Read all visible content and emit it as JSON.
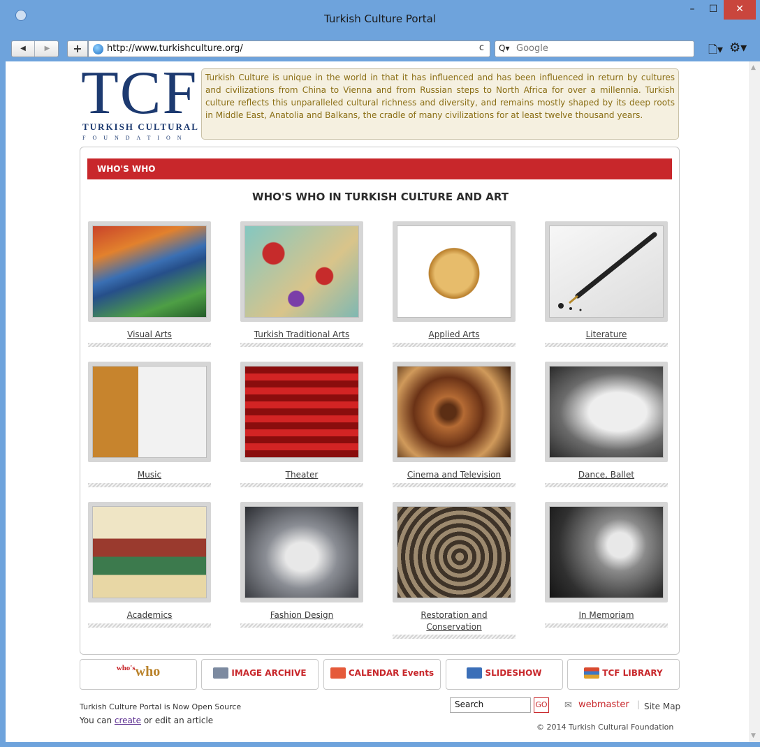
{
  "window": {
    "title": "Turkish Culture Portal",
    "min_glyph": "–",
    "max_glyph": "☐",
    "close_glyph": "✕"
  },
  "browser": {
    "url": "http://www.turkishculture.org/",
    "search_placeholder": "Google",
    "back_glyph": "◀",
    "forward_glyph": "▶",
    "plus_glyph": "+",
    "reload_glyph": "c",
    "search_glyph": "Q▾",
    "page_menu_glyph": "🗋▾",
    "tools_menu_glyph": "⚙▾"
  },
  "logo": {
    "big": "TCF",
    "line1": "TURKISH CULTURAL",
    "line2": "FOUNDATION"
  },
  "intro": "Turkish Culture is unique in the world in that it has influenced and has been influenced in return by cultures and civilizations from China to Vienna and from Russian steps to North Africa for over a millennia. Turkish culture reflects this unparalleled cultural richness and diversity, and remains mostly shaped by its deep roots in Middle East, Anatolia and Balkans, the cradle of many civilizations for at least twelve thousand years.",
  "section": {
    "bar_title": "WHO'S WHO",
    "heading": "WHO'S WHO IN TURKISH CULTURE AND ART"
  },
  "categories": [
    {
      "label": "Visual Arts",
      "image": "visual-arts-photo"
    },
    {
      "label": "Turkish Traditional Arts",
      "image": "marbling-photo"
    },
    {
      "label": "Applied Arts",
      "image": "golden-vase-photo"
    },
    {
      "label": "Literature",
      "image": "fountain-pen-photo"
    },
    {
      "label": "Music",
      "image": "musician-painting"
    },
    {
      "label": "Theater",
      "image": "theater-seats-photo"
    },
    {
      "label": "Cinema and Television",
      "image": "film-reel-photo"
    },
    {
      "label": "Dance, Ballet",
      "image": "ballet-dancer-photo"
    },
    {
      "label": "Academics",
      "image": "miniature-scholars-painting"
    },
    {
      "label": "Fashion Design",
      "image": "fashion-model-photo"
    },
    {
      "label": "Restoration and Conservation",
      "image": "inlay-restoration-photo"
    },
    {
      "label": "In Memoriam",
      "image": "glass-rose-photo"
    }
  ],
  "bottom_nav": {
    "whos_who_small": "who's",
    "whos_who_big": "who",
    "image_archive": "IMAGE ARCHIVE",
    "calendar": "CALENDAR Events",
    "slideshow": "SLIDESHOW",
    "library": "TCF LIBRARY"
  },
  "footer": {
    "open_source": "Turkish Culture Portal is Now Open Source",
    "you_can": "You can",
    "create_link": "create",
    "edit_text": "or edit an article",
    "search_value": "Search",
    "go_label": "GO",
    "mail_glyph": "✉",
    "webmaster": "webmaster",
    "separator": "|",
    "site_map": "Site Map",
    "copyright": "© 2014 Turkish Cultural Foundation"
  },
  "colors": {
    "accent_red": "#c8272b",
    "chrome_blue": "#6ea3dc",
    "logo_navy": "#1d3a70",
    "intro_text": "#8a6e14"
  }
}
